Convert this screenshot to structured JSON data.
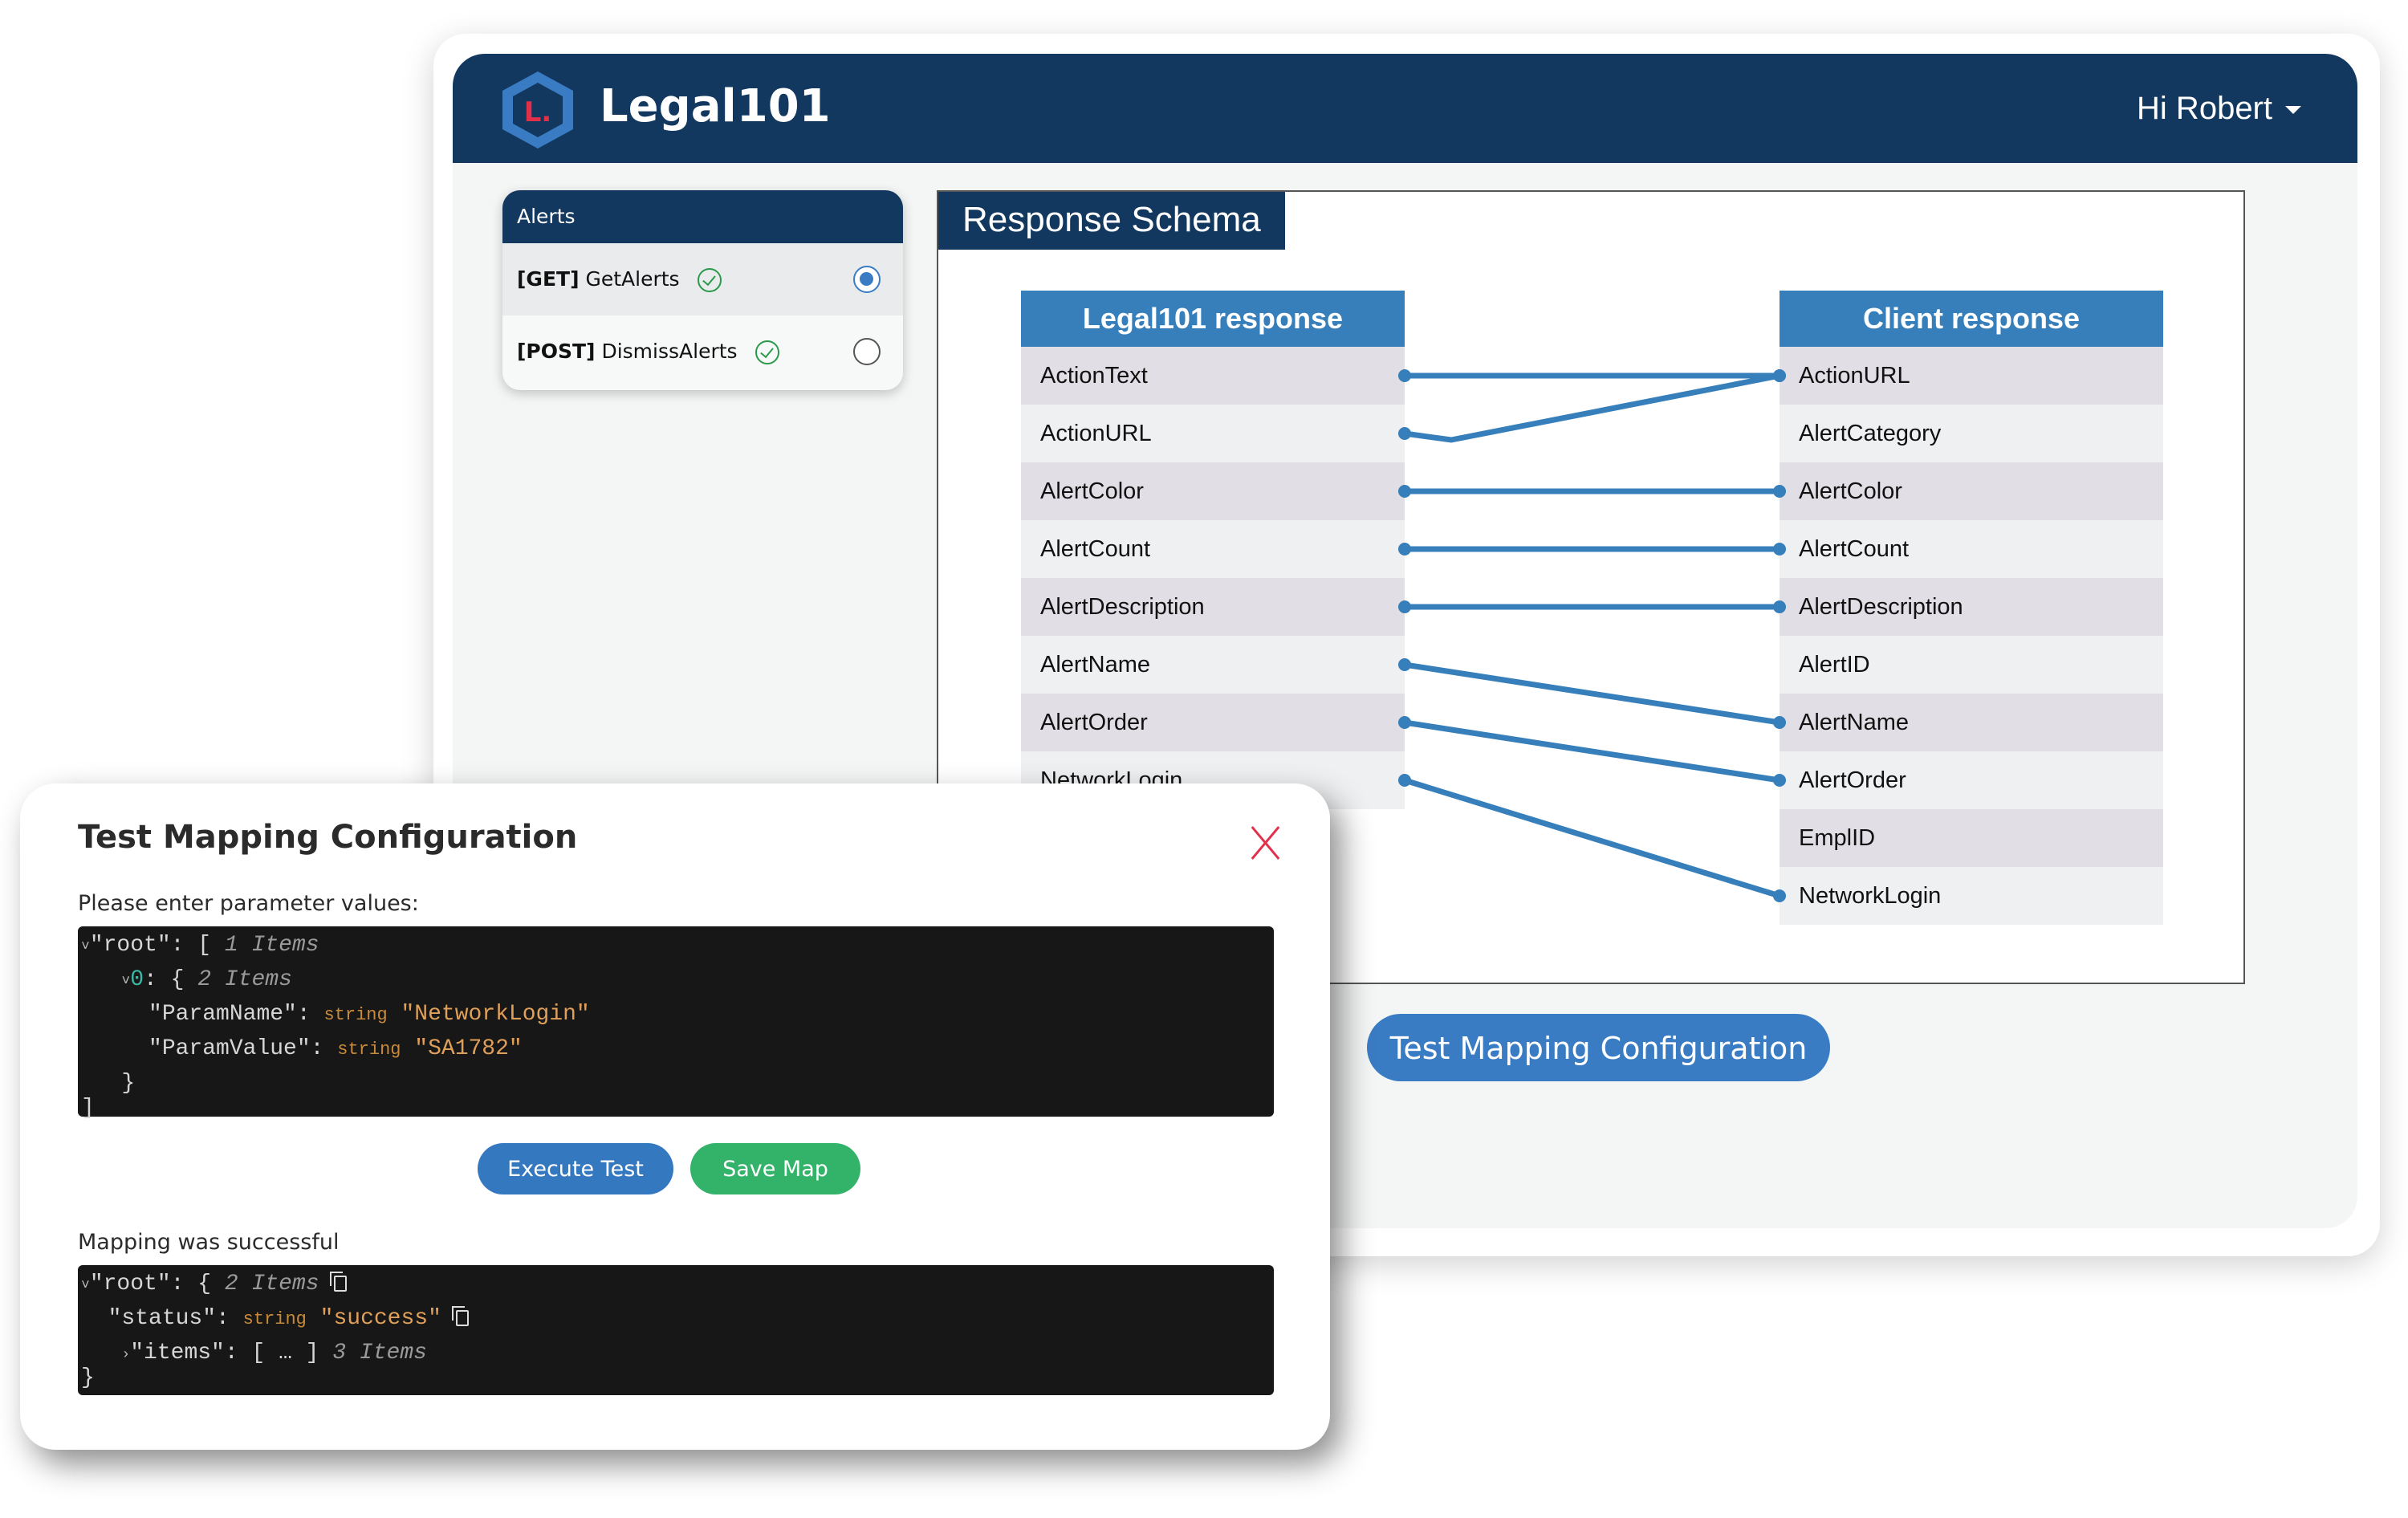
{
  "app": {
    "brand": "Legal101",
    "logo_letter": "L.",
    "user_greeting": "Hi Robert",
    "colors": {
      "navy": "#12385f",
      "accent": "#367fba",
      "success": "#33b36a",
      "danger": "#e0304a"
    }
  },
  "alerts_panel": {
    "title": "Alerts",
    "items": [
      {
        "method": "[GET]",
        "name": "GetAlerts",
        "status_icon": "check-circle-icon",
        "selected": true
      },
      {
        "method": "[POST]",
        "name": "DismissAlerts",
        "status_icon": "check-circle-icon",
        "selected": false
      }
    ]
  },
  "schema": {
    "title": "Response Schema",
    "left_header": "Legal101 response",
    "right_header": "Client response",
    "left_fields": [
      "ActionText",
      "ActionURL",
      "AlertColor",
      "AlertCount",
      "AlertDescription",
      "AlertName",
      "AlertOrder",
      "NetworkLogin"
    ],
    "right_fields": [
      "ActionURL",
      "AlertCategory",
      "AlertColor",
      "AlertCount",
      "AlertDescription",
      "AlertID",
      "AlertName",
      "AlertOrder",
      "EmplID",
      "NetworkLogin"
    ],
    "mappings": [
      {
        "from": "ActionText",
        "to": "ActionURL"
      },
      {
        "from": "ActionURL",
        "to": "ActionURL"
      },
      {
        "from": "AlertColor",
        "to": "AlertColor"
      },
      {
        "from": "AlertCount",
        "to": "AlertCount"
      },
      {
        "from": "AlertDescription",
        "to": "AlertDescription"
      },
      {
        "from": "AlertName",
        "to": "AlertName"
      },
      {
        "from": "AlertOrder",
        "to": "AlertOrder"
      },
      {
        "from": "NetworkLogin",
        "to": "NetworkLogin"
      }
    ],
    "test_button": "Test Mapping Configuration"
  },
  "modal": {
    "title": "Test Mapping Configuration",
    "params_label": "Please enter parameter values:",
    "params_json": {
      "root_key": "\"root\"",
      "root_open": "[",
      "root_count": "1 Items",
      "item_index": "0",
      "item_open": "{",
      "item_count": "2 Items",
      "param_name_key": "\"ParamName\"",
      "param_name_type": "string",
      "param_name_value": "\"NetworkLogin\"",
      "param_value_key": "\"ParamValue\"",
      "param_value_type": "string",
      "param_value_value": "\"SA1782\"",
      "item_close": "}",
      "root_close": "]"
    },
    "execute_button": "Execute Test",
    "save_button": "Save Map",
    "result_label": "Mapping was successful",
    "result_json": {
      "root_key": "\"root\"",
      "root_open": "{",
      "root_count": "2 Items",
      "status_key": "\"status\"",
      "status_type": "string",
      "status_value": "\"success\"",
      "items_key": "\"items\"",
      "items_collapsed": "[ … ]",
      "items_count": "3 Items",
      "root_close": "}"
    }
  }
}
